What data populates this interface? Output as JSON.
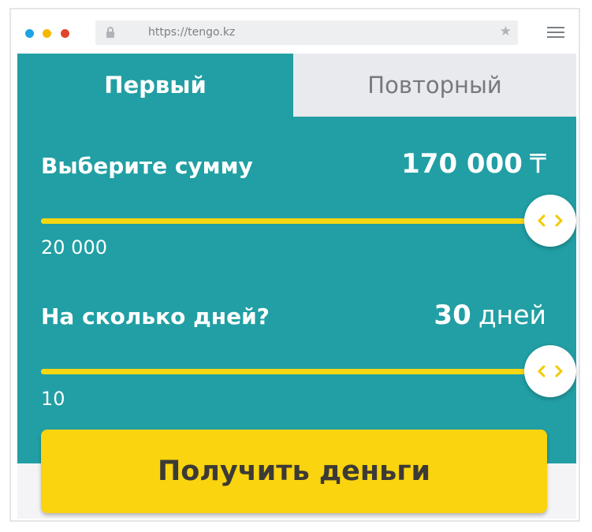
{
  "browser": {
    "url": "https://tengo.kz",
    "dot_colors": [
      "#1aa4e4",
      "#f5b800",
      "#e0452b"
    ],
    "icons": [
      "lock-icon",
      "star-icon",
      "menu-icon"
    ]
  },
  "tabs": [
    {
      "label": "Первый",
      "active": true
    },
    {
      "label": "Повторный",
      "active": false
    }
  ],
  "amount": {
    "label": "Выберите сумму",
    "value": "170 000",
    "currency": "₸",
    "min": "20 000",
    "fill_fraction": 1.0
  },
  "days": {
    "label": "На сколько дней?",
    "value": "30",
    "unit": "дней",
    "min": "10",
    "fill_fraction": 1.0
  },
  "cta": {
    "label": "Получить деньги"
  },
  "colors": {
    "panel": "#219fa4",
    "accent": "#f7d711",
    "button": "#f9d40f",
    "inactive_tab": "#e9eaed"
  }
}
